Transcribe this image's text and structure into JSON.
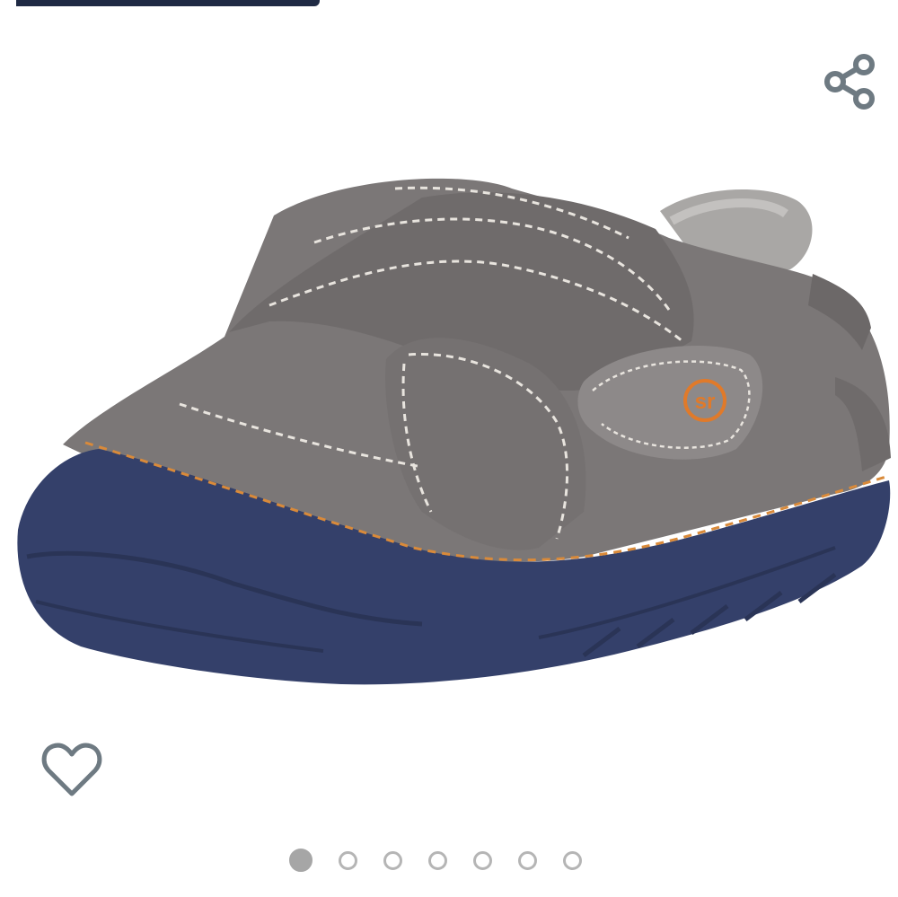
{
  "product_image": {
    "brand_logo_text": "sr",
    "colors": {
      "upper": "#7b7777",
      "upper_dark": "#5f5b5b",
      "sole": "#34406a",
      "stitch_top": "#e8e4de",
      "stitch_welt": "#d98a3a",
      "logo": "#e07a2a",
      "lining": "#a9a7a5"
    }
  },
  "actions": {
    "share_icon": "share-icon",
    "wishlist_icon": "heart-outline-icon",
    "icon_color": "#6e7a82"
  },
  "carousel": {
    "total_images": 7,
    "active_index": 1,
    "active_color": "#a6a6a6",
    "inactive_border": "#b5b5b5"
  }
}
